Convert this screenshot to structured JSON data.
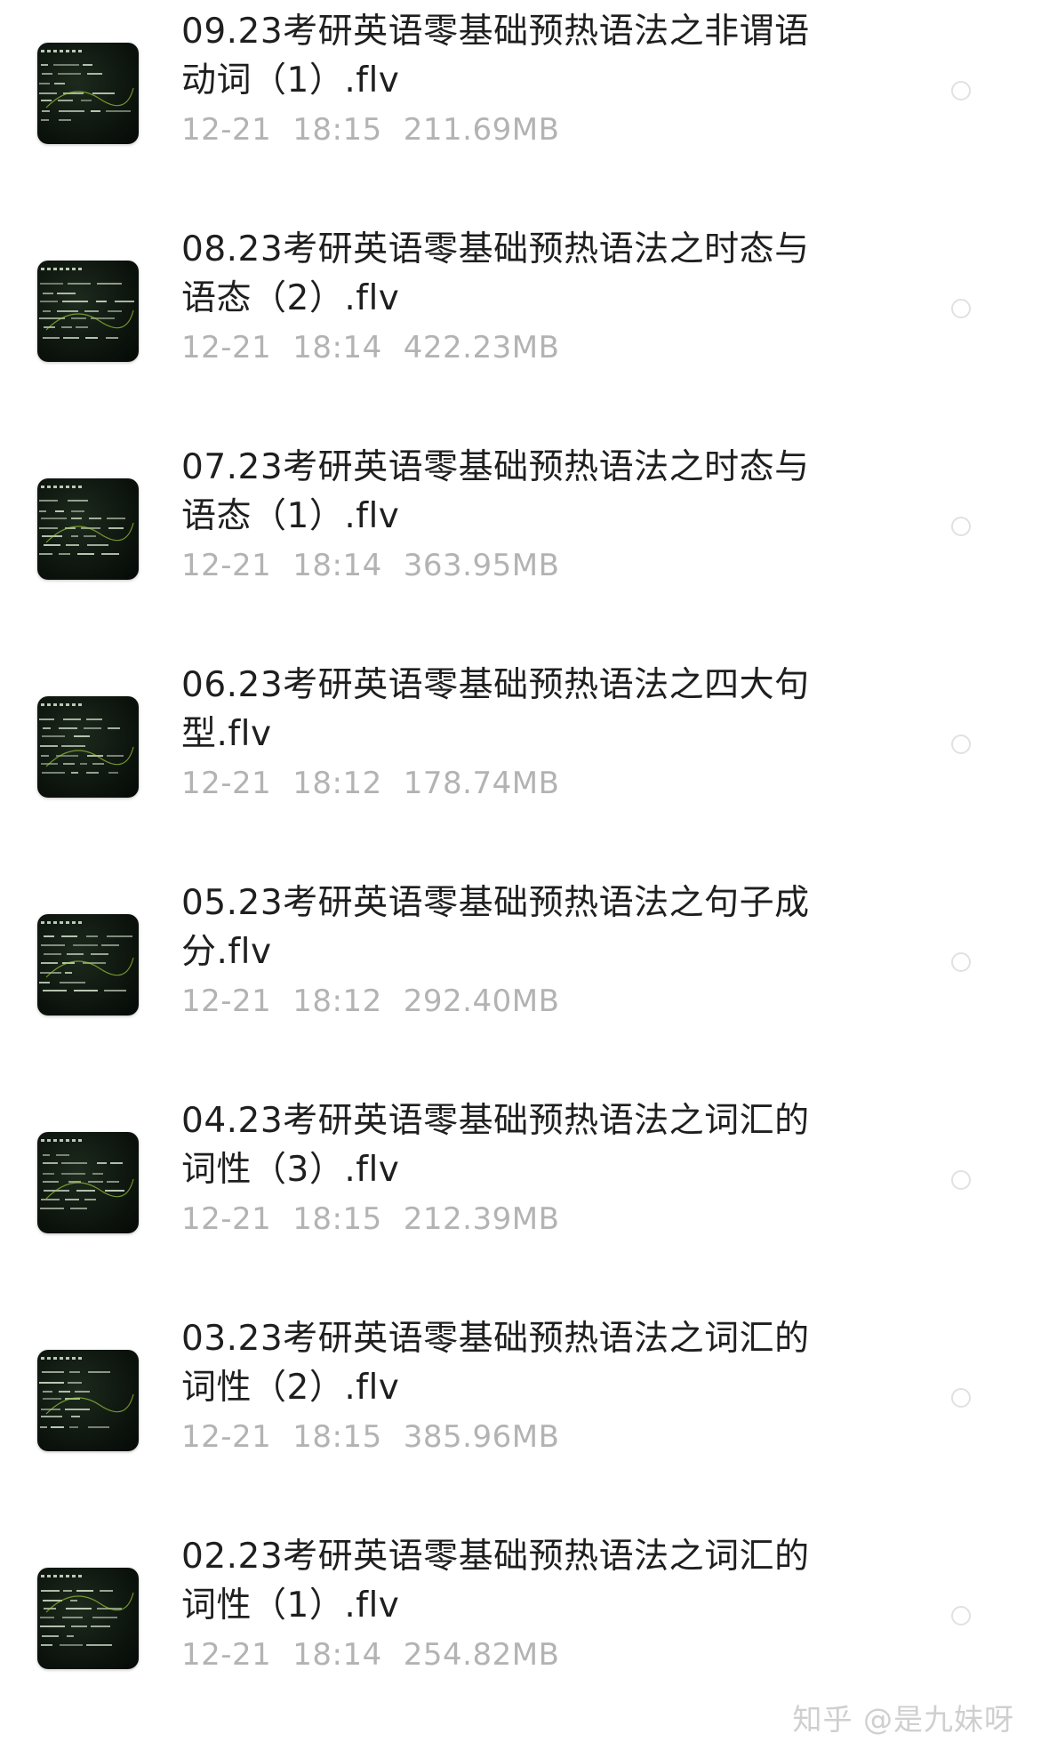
{
  "files": [
    {
      "title": "09.23考研英语零基础预热语法之非谓语动词（1）.flv",
      "date": "12-21",
      "time": "18:15",
      "size": "211.69MB",
      "selected": false,
      "thumbnail": "video-thumbnail-icon"
    },
    {
      "title": "08.23考研英语零基础预热语法之时态与语态（2）.flv",
      "date": "12-21",
      "time": "18:14",
      "size": "422.23MB",
      "selected": false,
      "thumbnail": "video-thumbnail-icon"
    },
    {
      "title": "07.23考研英语零基础预热语法之时态与语态（1）.flv",
      "date": "12-21",
      "time": "18:14",
      "size": "363.95MB",
      "selected": false,
      "thumbnail": "video-thumbnail-icon"
    },
    {
      "title": "06.23考研英语零基础预热语法之四大句型.flv",
      "date": "12-21",
      "time": "18:12",
      "size": "178.74MB",
      "selected": false,
      "thumbnail": "video-thumbnail-icon"
    },
    {
      "title": "05.23考研英语零基础预热语法之句子成分.flv",
      "date": "12-21",
      "time": "18:12",
      "size": "292.40MB",
      "selected": false,
      "thumbnail": "video-thumbnail-icon"
    },
    {
      "title": "04.23考研英语零基础预热语法之词汇的词性（3）.flv",
      "date": "12-21",
      "time": "18:15",
      "size": "212.39MB",
      "selected": false,
      "thumbnail": "video-thumbnail-icon"
    },
    {
      "title": "03.23考研英语零基础预热语法之词汇的词性（2）.flv",
      "date": "12-21",
      "time": "18:15",
      "size": "385.96MB",
      "selected": false,
      "thumbnail": "video-thumbnail-icon"
    },
    {
      "title": "02.23考研英语零基础预热语法之词汇的词性（1）.flv",
      "date": "12-21",
      "time": "18:14",
      "size": "254.82MB",
      "selected": false,
      "thumbnail": "video-thumbnail-icon"
    }
  ],
  "watermark": "知乎 @是九妹呀",
  "colors": {
    "title": "#1f1f1f",
    "meta": "#b3b3b3",
    "thumbnail_bg": "#0b120c",
    "chalk_text": "#d8e6d0",
    "chalk_highlight": "#9ccc3a",
    "radio_border": "#e1e1e1"
  }
}
